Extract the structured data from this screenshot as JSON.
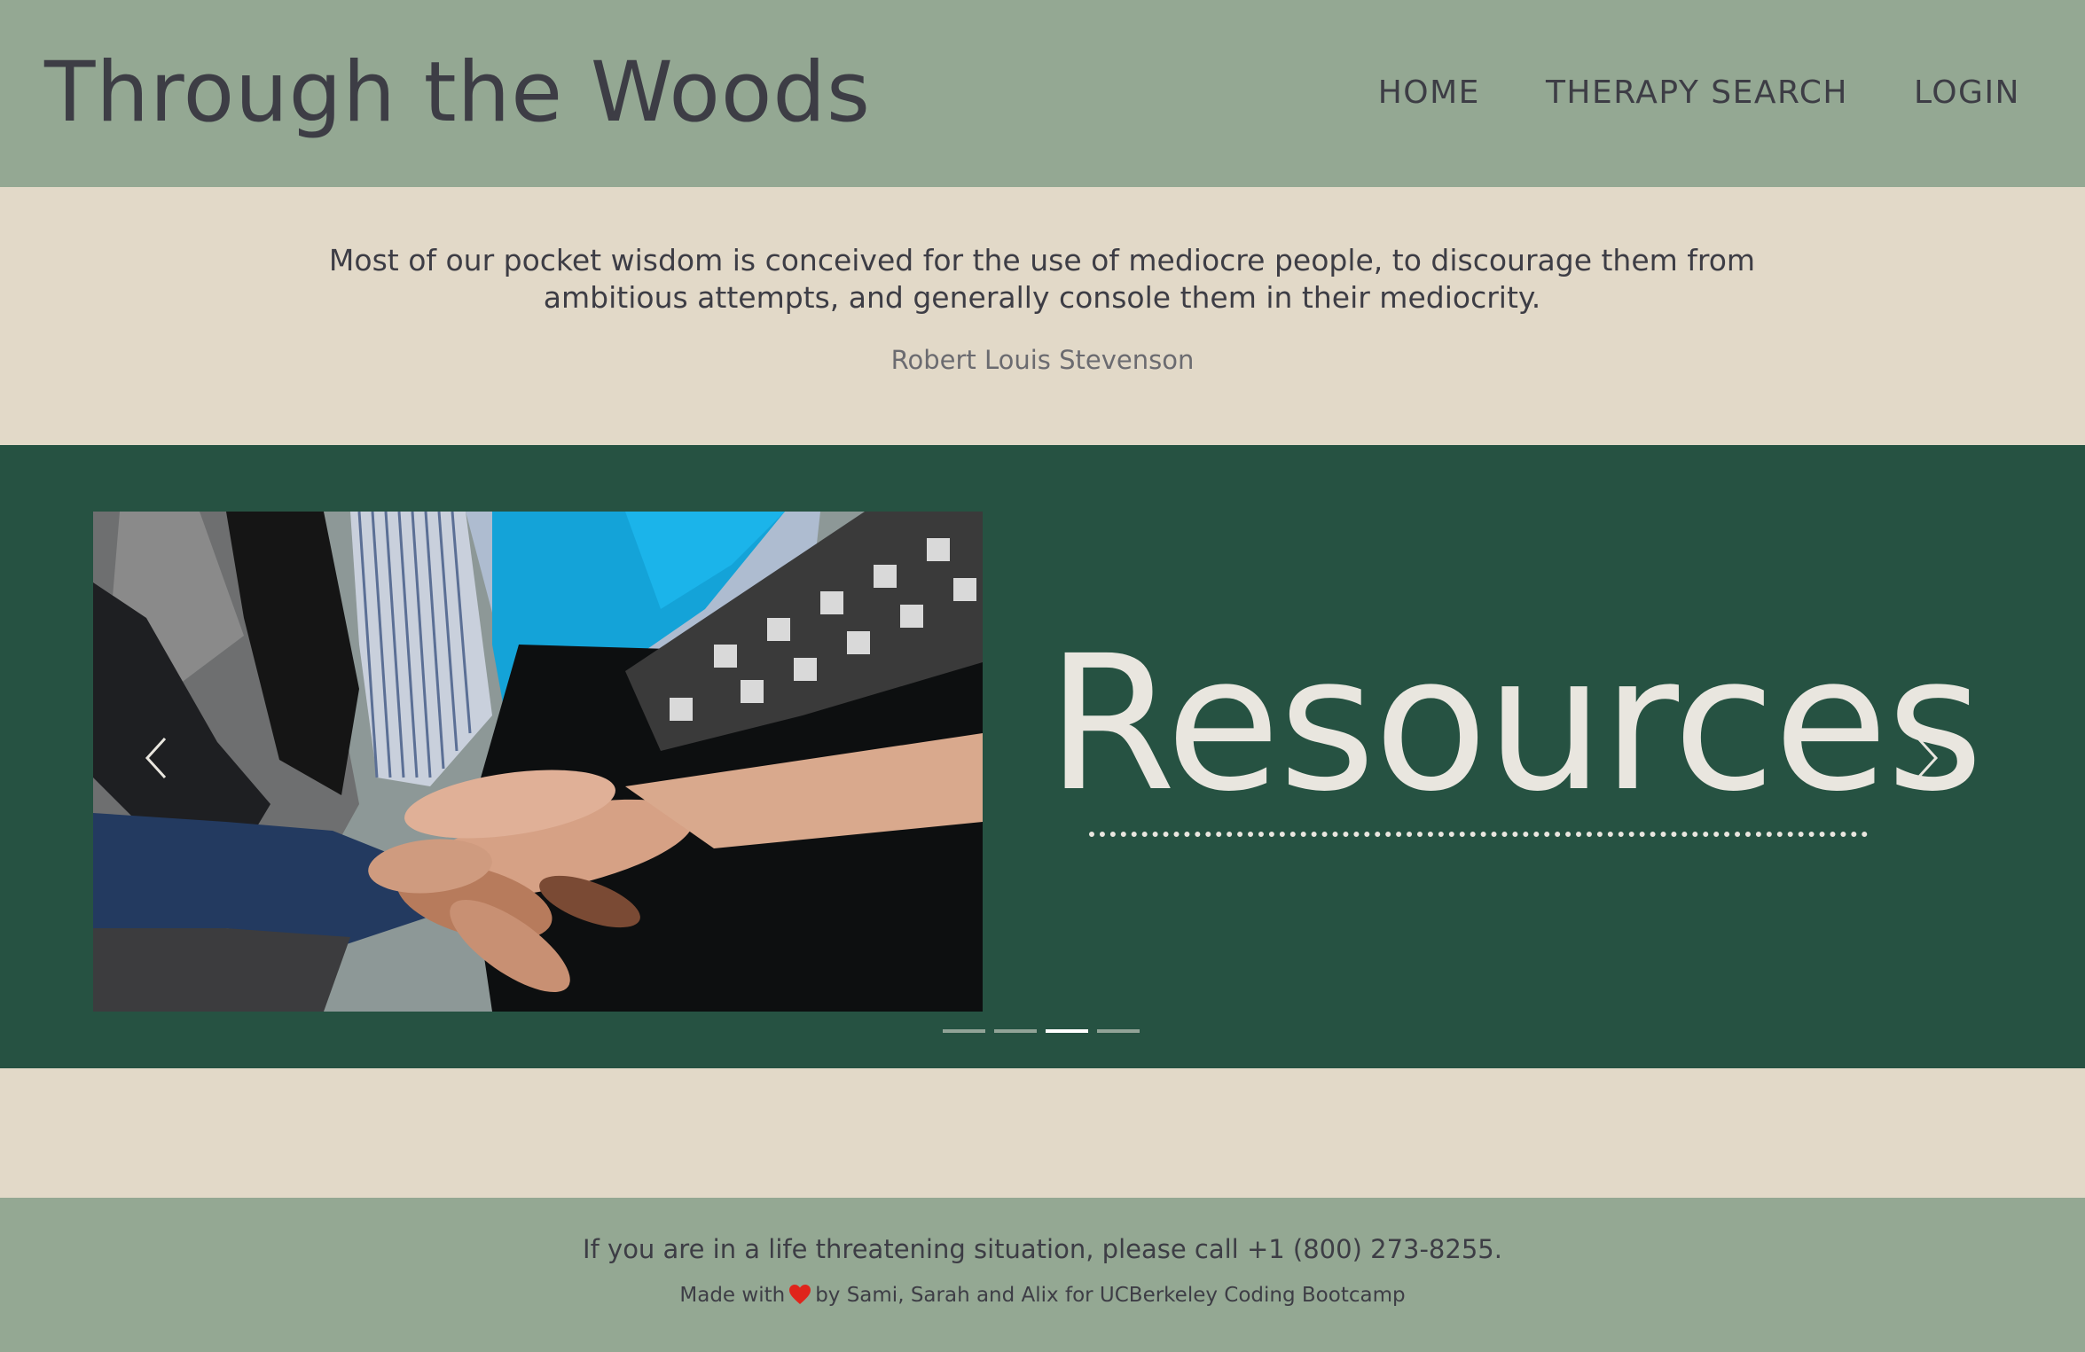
{
  "header": {
    "site_title": "Through the Woods",
    "nav": {
      "home": "HOME",
      "therapy_search": "THERAPY SEARCH",
      "login": "LOGIN"
    }
  },
  "quote": {
    "text": "Most of our pocket wisdom is conceived for the use of mediocre people, to discourage them from ambitious attempts, and generally console them in their mediocrity.",
    "author": "Robert Louis Stevenson"
  },
  "carousel": {
    "slide_title": "Resources",
    "slide_count": 4,
    "active_slide": 3,
    "prev_icon": "chevron-left-icon",
    "next_icon": "chevron-right-icon"
  },
  "footer": {
    "warning": "If you are in a life threatening situation, please call +1 (800) 273-8255.",
    "credit_prefix": "Made with",
    "credit_icon": "heart-icon",
    "credit_suffix": "by Sami, Sarah and Alix for UCBerkeley Coding Bootcamp"
  },
  "colors": {
    "header_bg": "#94a893",
    "page_bg": "#e2d9c8",
    "carousel_bg": "#265242",
    "text_dark": "#3d3d45",
    "slide_text": "#e9e6df",
    "heart": "#e0241b"
  }
}
